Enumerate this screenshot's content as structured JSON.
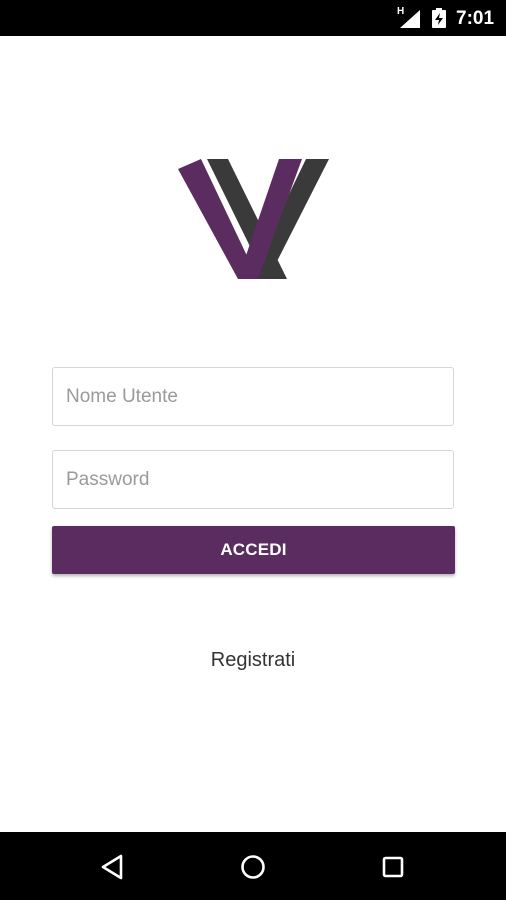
{
  "status_bar": {
    "network_type": "H",
    "time": "7:01",
    "icons": [
      "network-type-icon",
      "signal-icon",
      "battery-charging-icon"
    ]
  },
  "logo": {
    "icon": "logo-icon",
    "colors": {
      "primary": "#5b2c5f",
      "secondary": "#3a3a3a"
    }
  },
  "login_form": {
    "username": {
      "value": "",
      "placeholder": "Nome Utente"
    },
    "password": {
      "value": "",
      "placeholder": "Password"
    },
    "submit_label": "ACCEDI",
    "register_label": "Registrati"
  },
  "nav_bar": {
    "icons": [
      "back-icon",
      "home-icon",
      "recents-icon"
    ]
  },
  "colors": {
    "accent": "#5b2c5f",
    "text": "#333333",
    "placeholder": "#9a9a9a",
    "border": "#d6d6d6"
  }
}
